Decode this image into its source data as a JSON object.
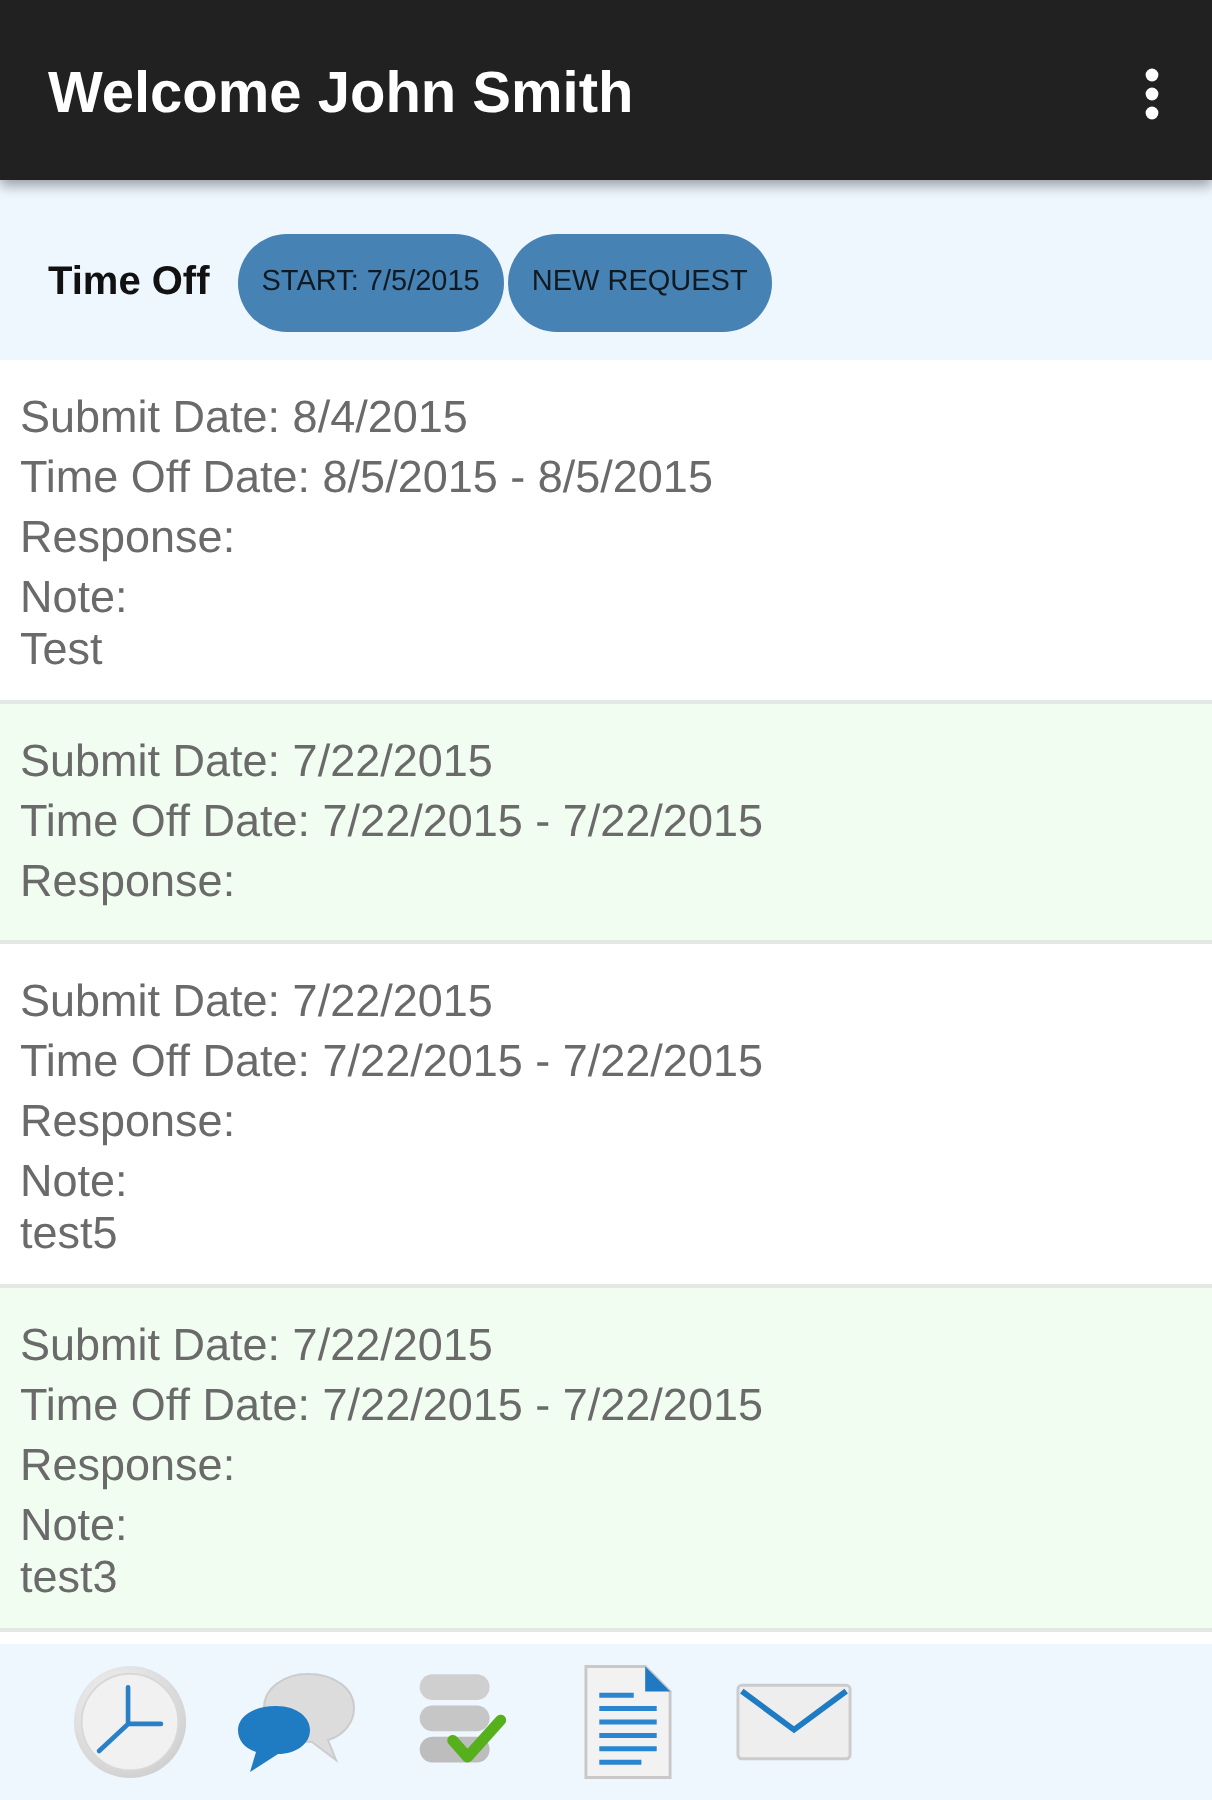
{
  "app_bar": {
    "title": "Welcome John Smith"
  },
  "toolbar": {
    "label": "Time Off",
    "buttons": [
      "START: 7/5/2015",
      "NEW REQUEST"
    ]
  },
  "requests": [
    {
      "submit_date": "Submit Date: 8/4/2015",
      "time_off_date": "Time Off Date: 8/5/2015 - 8/5/2015",
      "response": "Response:",
      "note_label": "Note:",
      "note": "Test"
    },
    {
      "submit_date": "Submit Date: 7/22/2015",
      "time_off_date": "Time Off Date: 7/22/2015 - 7/22/2015",
      "response": "Response:"
    },
    {
      "submit_date": "Submit Date: 7/22/2015",
      "time_off_date": "Time Off Date: 7/22/2015 - 7/22/2015",
      "response": "Response:",
      "note_label": "Note:",
      "note": "test5"
    },
    {
      "submit_date": "Submit Date: 7/22/2015",
      "time_off_date": "Time Off Date: 7/22/2015 - 7/22/2015",
      "response": "Response:",
      "note_label": "Note:",
      "note": "test3"
    }
  ],
  "bottom_nav": [
    {
      "kind": "clock"
    },
    {
      "kind": "chat"
    },
    {
      "kind": "database"
    },
    {
      "kind": "document"
    },
    {
      "kind": "mail"
    }
  ]
}
